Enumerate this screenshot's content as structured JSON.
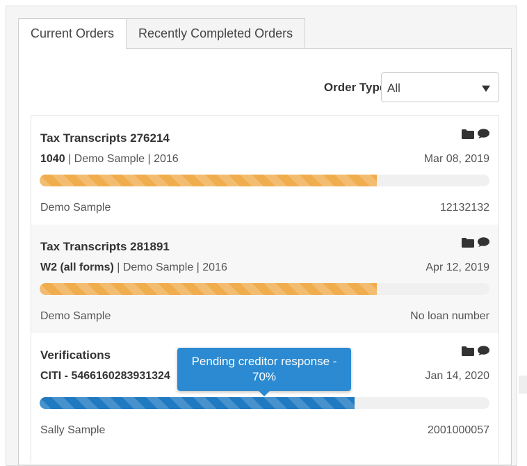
{
  "tabs": [
    {
      "label": "Current Orders",
      "active": true
    },
    {
      "label": "Recently Completed Orders",
      "active": false
    }
  ],
  "filter": {
    "label": "Order Type:",
    "selected": "All"
  },
  "orders": [
    {
      "title": "Tax Transcripts 276214",
      "sub_bold": "1040",
      "sub_rest": " | Demo Sample | 2016",
      "date": "Mar 08, 2019",
      "progress": 0.75,
      "progress_color": "#f0ad4e",
      "name": "Demo Sample",
      "number": "12132132"
    },
    {
      "title": "Tax Transcripts 281891",
      "sub_bold": "W2 (all forms)",
      "sub_rest": " | Demo Sample | 2016",
      "date": "Apr 12, 2019",
      "progress": 0.75,
      "progress_color": "#f0ad4e",
      "name": "Demo Sample",
      "number": "No loan number"
    },
    {
      "title": "Verifications",
      "sub_bold": "CITI - 5466160283931324",
      "sub_rest": "",
      "date": "Jan 14, 2020",
      "progress": 0.7,
      "progress_color": "#1f7ac1",
      "name": "Sally Sample",
      "number": "2001000057"
    }
  ],
  "tooltip": {
    "line1": "Pending creditor response -",
    "line2": "70%"
  },
  "icons": [
    "folder-icon",
    "comment-icon"
  ]
}
